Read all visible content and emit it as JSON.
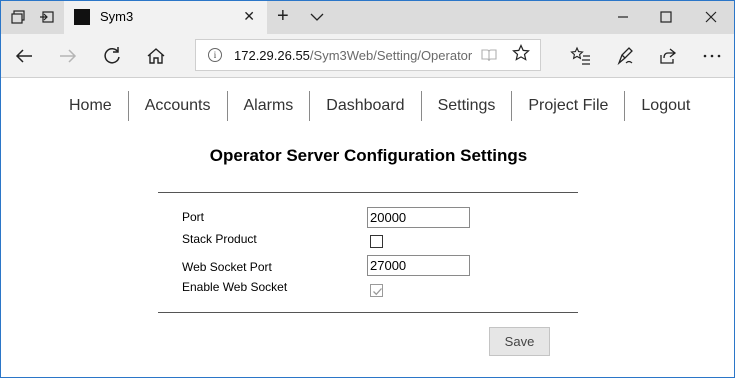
{
  "browser": {
    "tab": {
      "title": "Sym3"
    },
    "address": {
      "host": "172.29.26.55",
      "path": "/Sym3Web/Setting/Operator"
    }
  },
  "menu": {
    "items": [
      {
        "label": "Home"
      },
      {
        "label": "Accounts"
      },
      {
        "label": "Alarms"
      },
      {
        "label": "Dashboard"
      },
      {
        "label": "Settings"
      },
      {
        "label": "Project File"
      },
      {
        "label": "Logout"
      }
    ]
  },
  "page": {
    "title": "Operator Server Configuration Settings"
  },
  "form": {
    "port": {
      "label": "Port",
      "value": "20000"
    },
    "stack_product": {
      "label": "Stack Product",
      "checked": false
    },
    "web_socket_port": {
      "label": "Web Socket Port",
      "value": "27000"
    },
    "enable_web_socket": {
      "label": "Enable Web Socket",
      "checked": true,
      "disabled": true
    },
    "save_label": "Save"
  },
  "icons": {
    "tab_favicon": "black-square-icon",
    "close": "close-icon",
    "back": "back-arrow-icon",
    "forward": "forward-arrow-icon",
    "refresh": "refresh-icon",
    "home": "home-icon",
    "favorite": "star-icon",
    "reading_view": "book-icon"
  }
}
